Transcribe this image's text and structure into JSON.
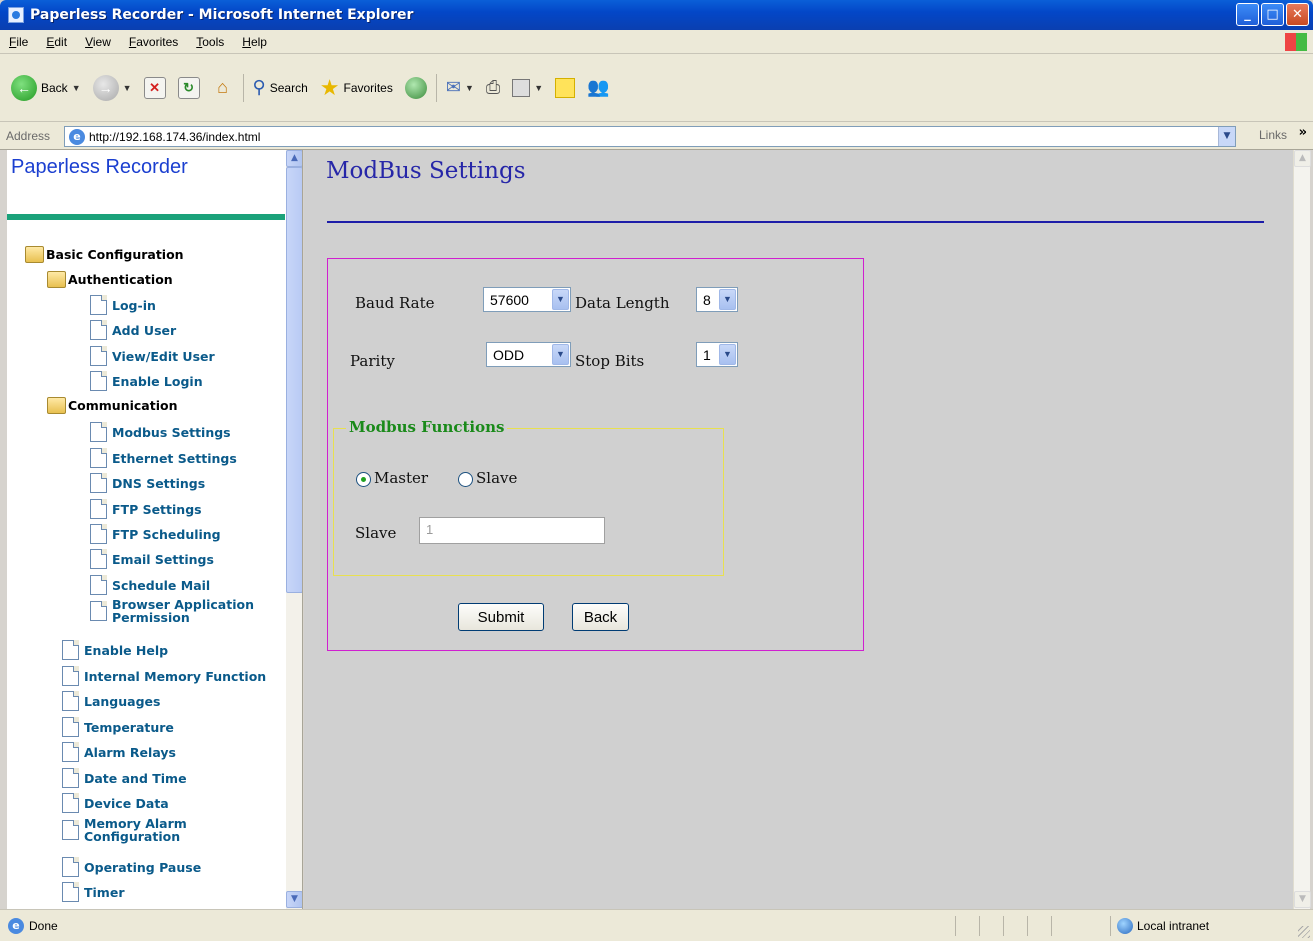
{
  "window": {
    "title": "Paperless Recorder - Microsoft Internet Explorer"
  },
  "menu": [
    "File",
    "Edit",
    "View",
    "Favorites",
    "Tools",
    "Help"
  ],
  "toolbar": {
    "back_label": "Back",
    "search_label": "Search",
    "favorites_label": "Favorites"
  },
  "address": {
    "label": "Address",
    "url": "http://192.168.174.36/index.html",
    "links_label": "Links"
  },
  "sidebar": {
    "title": "Paperless Recorder",
    "items": [
      {
        "label": "Basic Configuration",
        "type": "folder"
      },
      {
        "label": "Authentication",
        "type": "folder"
      },
      {
        "label": "Log-in",
        "type": "doc"
      },
      {
        "label": "Add User",
        "type": "doc"
      },
      {
        "label": "View/Edit User",
        "type": "doc"
      },
      {
        "label": "Enable Login",
        "type": "doc"
      },
      {
        "label": "Communication",
        "type": "folder"
      },
      {
        "label": "Modbus Settings",
        "type": "doc"
      },
      {
        "label": "Ethernet Settings",
        "type": "doc"
      },
      {
        "label": "DNS Settings",
        "type": "doc"
      },
      {
        "label": "FTP Settings",
        "type": "doc"
      },
      {
        "label": "FTP Scheduling",
        "type": "doc"
      },
      {
        "label": "Email Settings",
        "type": "doc"
      },
      {
        "label": "Schedule Mail",
        "type": "doc"
      },
      {
        "label": "Browser Application Permission",
        "type": "doc"
      },
      {
        "label": "Enable Help",
        "type": "doc"
      },
      {
        "label": "Internal Memory Function",
        "type": "doc"
      },
      {
        "label": "Languages",
        "type": "doc"
      },
      {
        "label": "Temperature",
        "type": "doc"
      },
      {
        "label": "Alarm Relays",
        "type": "doc"
      },
      {
        "label": "Date and Time",
        "type": "doc"
      },
      {
        "label": "Device Data",
        "type": "doc"
      },
      {
        "label": "Memory Alarm Configuration",
        "type": "doc"
      },
      {
        "label": "Operating Pause",
        "type": "doc"
      },
      {
        "label": "Timer",
        "type": "doc"
      }
    ]
  },
  "main": {
    "title": "ModBus Settings",
    "baud_rate": {
      "label": "Baud Rate",
      "value": "57600"
    },
    "data_length": {
      "label": "Data Length",
      "value": "8"
    },
    "parity": {
      "label": "Parity",
      "value": "ODD"
    },
    "stop_bits": {
      "label": "Stop Bits",
      "value": "1"
    },
    "functions": {
      "legend": "Modbus Functions",
      "master_label": "Master",
      "slave_label": "Slave",
      "selected": "Master",
      "slave_id_label": "Slave",
      "slave_id_value": "1"
    },
    "submit_label": "Submit",
    "back_label": "Back"
  },
  "status": {
    "text": "Done",
    "zone": "Local intranet"
  },
  "colors": {
    "title_blue": "#2626a8",
    "sidebar_title": "#1b3fd0",
    "tree_link": "#0a5a8a",
    "accent_green": "#1aa27a",
    "box_border": "#d020d0",
    "legend_green": "#1a8a1a"
  }
}
